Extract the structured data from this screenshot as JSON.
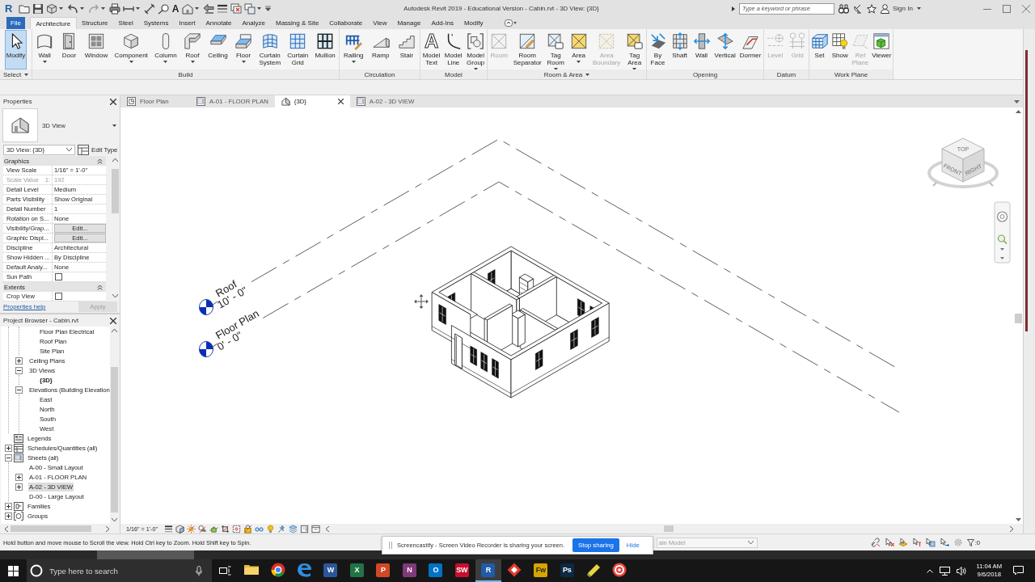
{
  "title_bar": {
    "logo": "R",
    "title": "Autodesk Revit 2019 - Educational Version - Cabin.rvt - 3D View: {3D}",
    "search": {
      "placeholder": "Type a keyword or phrase"
    },
    "sign_in": "Sign In"
  },
  "quick_access": {
    "text_tool": "A"
  },
  "ribbon_tabs": [
    {
      "label": "File",
      "kind": "file",
      "selected": false
    },
    {
      "label": "Architecture",
      "kind": "tab",
      "selected": true
    },
    {
      "label": "Structure",
      "kind": "tab",
      "selected": false
    },
    {
      "label": "Steel",
      "kind": "tab",
      "selected": false
    },
    {
      "label": "Systems",
      "kind": "tab",
      "selected": false
    },
    {
      "label": "Insert",
      "kind": "tab",
      "selected": false
    },
    {
      "label": "Annotate",
      "kind": "tab",
      "selected": false
    },
    {
      "label": "Analyze",
      "kind": "tab",
      "selected": false
    },
    {
      "label": "Massing & Site",
      "kind": "tab",
      "selected": false
    },
    {
      "label": "Collaborate",
      "kind": "tab",
      "selected": false
    },
    {
      "label": "View",
      "kind": "tab",
      "selected": false
    },
    {
      "label": "Manage",
      "kind": "tab",
      "selected": false
    },
    {
      "label": "Add-Ins",
      "kind": "tab",
      "selected": false
    },
    {
      "label": "Modify",
      "kind": "tab",
      "selected": false
    }
  ],
  "ribbon_panels": [
    {
      "title": "Select",
      "dropdown": true,
      "tools": [
        {
          "label": "Modify",
          "selected": true,
          "disabled": false,
          "dropdown": false
        }
      ]
    },
    {
      "title": "Build",
      "dropdown": false,
      "tools": [
        {
          "label": "Wall",
          "selected": false,
          "disabled": false,
          "dropdown": true
        },
        {
          "label": "Door",
          "selected": false,
          "disabled": false,
          "dropdown": false
        },
        {
          "label": "Window",
          "selected": false,
          "disabled": false,
          "dropdown": false
        },
        {
          "label": "Component",
          "selected": false,
          "disabled": false,
          "dropdown": true
        },
        {
          "label": "Column",
          "selected": false,
          "disabled": false,
          "dropdown": true
        },
        {
          "label": "Roof",
          "selected": false,
          "disabled": false,
          "dropdown": true
        },
        {
          "label": "Ceiling",
          "selected": false,
          "disabled": false,
          "dropdown": false
        },
        {
          "label": "Floor",
          "selected": false,
          "disabled": false,
          "dropdown": true
        },
        {
          "label": "Curtain System",
          "selected": false,
          "disabled": false,
          "dropdown": false
        },
        {
          "label": "Curtain Grid",
          "selected": false,
          "disabled": false,
          "dropdown": false
        },
        {
          "label": "Mullion",
          "selected": false,
          "disabled": false,
          "dropdown": false
        }
      ]
    },
    {
      "title": "Circulation",
      "dropdown": false,
      "tools": [
        {
          "label": "Railing",
          "selected": false,
          "disabled": false,
          "dropdown": true
        },
        {
          "label": "Ramp",
          "selected": false,
          "disabled": false,
          "dropdown": false
        },
        {
          "label": "Stair",
          "selected": false,
          "disabled": false,
          "dropdown": false
        }
      ]
    },
    {
      "title": "Model",
      "dropdown": false,
      "tools": [
        {
          "label": "Model Text",
          "glyph": "A",
          "selected": false,
          "disabled": false,
          "dropdown": false
        },
        {
          "label": "Model Line",
          "selected": false,
          "disabled": false,
          "dropdown": false
        },
        {
          "label": "Model Group",
          "selected": false,
          "disabled": false,
          "dropdown": true
        }
      ]
    },
    {
      "title": "Room & Area",
      "dropdown": true,
      "tools": [
        {
          "label": "Room",
          "selected": false,
          "disabled": true,
          "dropdown": false
        },
        {
          "label": "Room Separator",
          "selected": false,
          "disabled": false,
          "dropdown": false
        },
        {
          "label": "Tag Room",
          "selected": false,
          "disabled": false,
          "dropdown": true
        },
        {
          "label": "Area",
          "selected": false,
          "disabled": false,
          "dropdown": true
        },
        {
          "label": "Area Boundary",
          "selected": false,
          "disabled": true,
          "dropdown": false
        },
        {
          "label": "Tag Area",
          "selected": false,
          "disabled": false,
          "dropdown": true
        }
      ]
    },
    {
      "title": "Opening",
      "dropdown": false,
      "tools": [
        {
          "label": "By Face",
          "selected": false,
          "disabled": false,
          "dropdown": false
        },
        {
          "label": "Shaft",
          "selected": false,
          "disabled": false,
          "dropdown": false
        },
        {
          "label": "Wall",
          "selected": false,
          "disabled": false,
          "dropdown": false
        },
        {
          "label": "Vertical",
          "selected": false,
          "disabled": false,
          "dropdown": false
        },
        {
          "label": "Dormer",
          "selected": false,
          "disabled": false,
          "dropdown": false
        }
      ]
    },
    {
      "title": "Datum",
      "dropdown": false,
      "tools": [
        {
          "label": "Level",
          "selected": false,
          "disabled": true,
          "dropdown": false
        },
        {
          "label": "Grid",
          "selected": false,
          "disabled": true,
          "dropdown": false
        }
      ]
    },
    {
      "title": "Work Plane",
      "dropdown": false,
      "tools": [
        {
          "label": "Set",
          "selected": false,
          "disabled": false,
          "dropdown": false
        },
        {
          "label": "Show",
          "selected": false,
          "disabled": false,
          "dropdown": false
        },
        {
          "label": "Ref Plane",
          "selected": false,
          "disabled": true,
          "dropdown": false
        },
        {
          "label": "Viewer",
          "selected": false,
          "disabled": false,
          "dropdown": false
        }
      ]
    }
  ],
  "properties": {
    "title": "Properties",
    "type_name": "3D View",
    "instance": "3D View: {3D}",
    "edit_type": "Edit Type",
    "groups": [
      {
        "title": "Graphics",
        "expanded": true,
        "rows": [
          {
            "label": "View Scale",
            "kind": "text",
            "value": "1/16\" = 1'-0\"",
            "disabled": false
          },
          {
            "label": "Scale Value",
            "unit": "1:",
            "kind": "text",
            "value": "192",
            "disabled": true
          },
          {
            "label": "Detail Level",
            "kind": "text",
            "value": "Medium",
            "disabled": false
          },
          {
            "label": "Parts Visibility",
            "kind": "text",
            "value": "Show Original",
            "disabled": false
          },
          {
            "label": "Detail Number",
            "kind": "text",
            "value": "1",
            "disabled": false
          },
          {
            "label": "Rotation on S...",
            "kind": "text",
            "value": "None",
            "disabled": false
          },
          {
            "label": "Visibility/Grap...",
            "kind": "button",
            "value": "Edit...",
            "disabled": false
          },
          {
            "label": "Graphic Displ...",
            "kind": "button",
            "value": "Edit...",
            "disabled": false
          },
          {
            "label": "Discipline",
            "kind": "text",
            "value": "Architectural",
            "disabled": false
          },
          {
            "label": "Show Hidden ...",
            "kind": "text",
            "value": "By Discipline",
            "disabled": false
          },
          {
            "label": "Default Analy...",
            "kind": "text",
            "value": "None",
            "disabled": false
          },
          {
            "label": "Sun Path",
            "kind": "checkbox",
            "checked": false,
            "disabled": false
          }
        ]
      },
      {
        "title": "Extents",
        "expanded": true,
        "rows": [
          {
            "label": "Crop View",
            "kind": "checkbox",
            "checked": false,
            "disabled": false
          }
        ]
      }
    ],
    "help": "Properties help",
    "apply": {
      "label": "Apply",
      "disabled": true
    }
  },
  "project_browser": {
    "title": "Project Browser - Cabin.rvt",
    "tree": [
      {
        "children": [
          {
            "children": [
              {
                "label": "Floor Plan Electrical",
                "selected": false,
                "current": false
              },
              {
                "label": "Roof Plan",
                "selected": false,
                "current": false
              },
              {
                "label": "Site Plan",
                "selected": false,
                "current": false
              }
            ]
          },
          {
            "label": "Ceiling Plans",
            "expanded": false,
            "selected": false,
            "current": false
          },
          {
            "label": "3D Views",
            "expanded": true,
            "selected": false,
            "current": false,
            "children": [
              {
                "label": "{3D}",
                "selected": false,
                "current": true
              }
            ]
          },
          {
            "label": "Elevations (Building Elevation",
            "expanded": true,
            "selected": false,
            "current": false,
            "children": [
              {
                "label": "East",
                "selected": false,
                "current": false
              },
              {
                "label": "North",
                "selected": false,
                "current": false
              },
              {
                "label": "South",
                "selected": false,
                "current": false
              },
              {
                "label": "West",
                "selected": false,
                "current": false
              }
            ]
          }
        ]
      },
      {
        "label": "Legends",
        "selected": false,
        "current": false
      },
      {
        "label": "Schedules/Quantities (all)",
        "expanded": false,
        "selected": false,
        "current": false
      },
      {
        "label": "Sheets (all)",
        "expanded": true,
        "selected": false,
        "current": false,
        "children": [
          {
            "label": "A-00 - Small Layout",
            "selected": false,
            "current": false
          },
          {
            "label": "A-01 - FLOOR PLAN",
            "expanded": false,
            "selected": false,
            "current": false
          },
          {
            "label": "A-02 - 3D VIEW",
            "expanded": false,
            "selected": true,
            "current": false
          },
          {
            "label": "D-00 - Large Layout",
            "selected": false,
            "current": false
          }
        ]
      },
      {
        "label": "Families",
        "expanded": false,
        "selected": false,
        "current": false
      },
      {
        "label": "Groups",
        "expanded": false,
        "selected": false,
        "current": false
      }
    ]
  },
  "view_tabs": [
    {
      "label": "Floor Plan",
      "kind": "plan",
      "selected": false
    },
    {
      "label": "A-01 - FLOOR PLAN",
      "kind": "sheet",
      "selected": false
    },
    {
      "label": "{3D}",
      "kind": "model",
      "selected": true
    },
    {
      "label": "A-02 - 3D VIEW",
      "kind": "sheet",
      "selected": false
    }
  ],
  "view": {
    "levels": [
      {
        "name": "Roof",
        "elevation": "10' - 0\""
      },
      {
        "name": "Floor Plan",
        "elevation": "0' - 0\""
      }
    ],
    "view_cube": {
      "faces": [
        "TOP",
        "FRONT",
        "RIGHT"
      ]
    }
  },
  "view_control": {
    "scale": "1/16\" = 1'-0\""
  },
  "status_bar": {
    "message": "Hold button and move mouse to Scroll the view. Hold Ctrl key to Zoom. Hold Shift key to Spin.",
    "model": "ain Model",
    "filter_count": ":0"
  },
  "share_bar": {
    "message": "Screencastify - Screen Video Recorder is sharing your screen.",
    "stop": "Stop sharing",
    "hide": "Hide"
  },
  "taskbar": {
    "search": {
      "placeholder": "Type here to search"
    },
    "apps": [
      {
        "kind": "icon",
        "active": false
      },
      {
        "kind": "icon",
        "active": false
      },
      {
        "kind": "icon",
        "active": false
      },
      {
        "kind": "tile",
        "glyph": "W",
        "color": "#2b579a",
        "active": false
      },
      {
        "kind": "tile",
        "glyph": "X",
        "color": "#217346",
        "active": false
      },
      {
        "kind": "tile",
        "glyph": "P",
        "color": "#d24726",
        "active": false
      },
      {
        "kind": "tile",
        "glyph": "N",
        "color": "#80397b",
        "active": false
      },
      {
        "kind": "tile",
        "glyph": "O",
        "color": "#0072c6",
        "active": false
      },
      {
        "kind": "tile",
        "glyph": "SW",
        "color": "#c8102e",
        "active": false
      },
      {
        "kind": "tile",
        "glyph": "R",
        "color": "#1f5ca8",
        "active": true
      },
      {
        "kind": "icon",
        "active": false
      },
      {
        "kind": "tile",
        "glyph": "Fw",
        "color": "#d9a400",
        "active": false
      },
      {
        "kind": "tile",
        "glyph": "Ps",
        "color": "#0b2a45",
        "active": false
      },
      {
        "kind": "icon",
        "active": false
      },
      {
        "kind": "icon",
        "active": false
      }
    ],
    "time": "11:04 AM",
    "date": "9/6/2018"
  }
}
